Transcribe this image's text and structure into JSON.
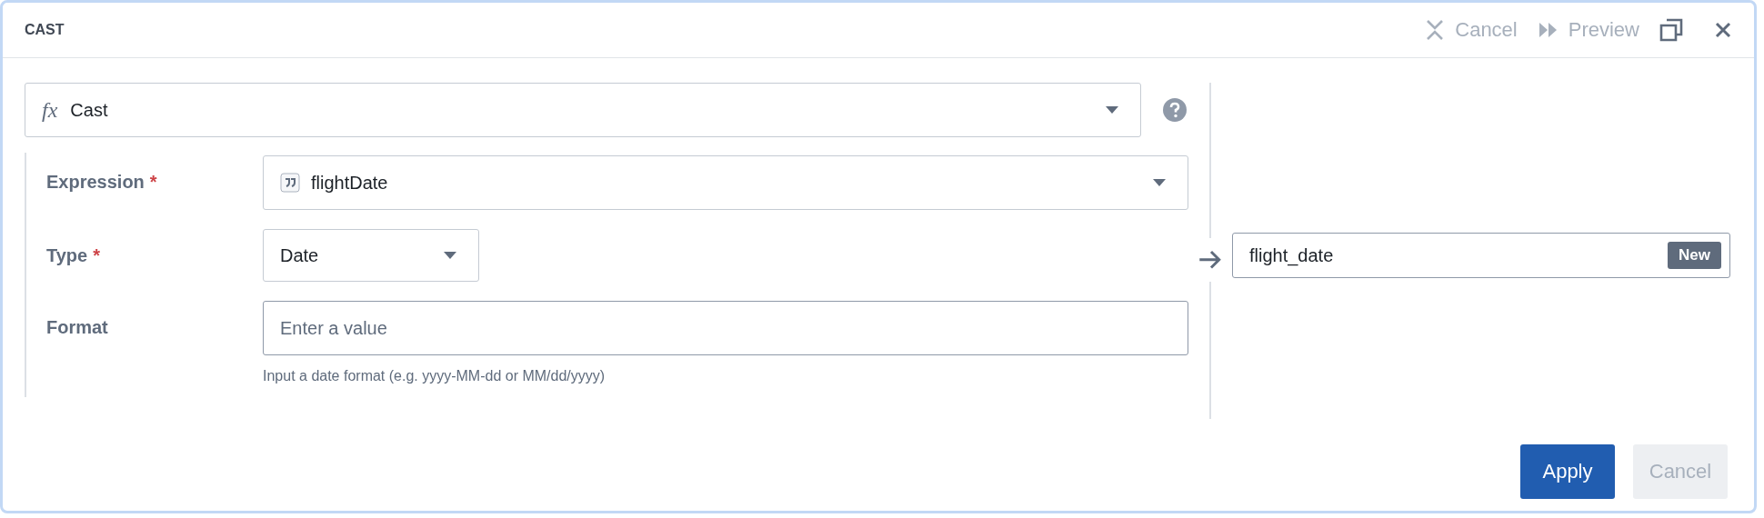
{
  "panel": {
    "title": "CAST",
    "actions": [
      {
        "kind": "cancel",
        "label": "Cancel",
        "disabled": true
      },
      {
        "kind": "preview",
        "label": "Preview",
        "disabled": true
      }
    ]
  },
  "function_select": {
    "icon": "fx",
    "value": "Cast"
  },
  "fields": [
    {
      "kind": "column-select",
      "label": "Expression",
      "required_marker": "*",
      "value": "flightDate"
    },
    {
      "kind": "select",
      "label": "Type",
      "required_marker": "*",
      "value": "Date"
    },
    {
      "kind": "text",
      "label": "Format",
      "placeholder": "Enter a value",
      "hint": "Input a date format (e.g. yyyy-MM-dd or MM/dd/yyyy)"
    }
  ],
  "output": {
    "value": "flight_date",
    "badge": "New"
  },
  "buttons": [
    {
      "kind": "primary",
      "label": "Apply",
      "disabled": false
    },
    {
      "kind": "default",
      "label": "Cancel",
      "disabled": true
    }
  ]
}
